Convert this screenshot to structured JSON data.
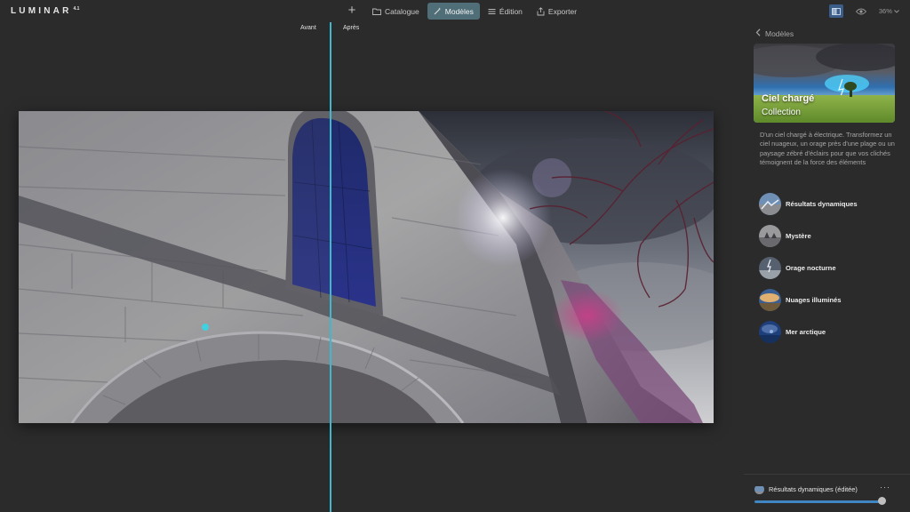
{
  "app": {
    "name": "LUMINAR",
    "version": "4.1"
  },
  "toolbar": {
    "add_label": "+",
    "tabs": [
      {
        "label": "Catalogue",
        "icon": "folder-icon",
        "active": false
      },
      {
        "label": "Modèles",
        "icon": "wand-icon",
        "active": true
      },
      {
        "label": "Édition",
        "icon": "sliders-icon",
        "active": false
      },
      {
        "label": "Exporter",
        "icon": "share-icon",
        "active": false
      }
    ],
    "zoom": "36%"
  },
  "canvas": {
    "before_label": "Avant",
    "after_label": "Après",
    "split_position": 0.45
  },
  "panel": {
    "back_label": "Modèles",
    "collection_title": "Ciel chargé",
    "collection_subtitle": "Collection",
    "description": "D'un ciel chargé à électrique. Transformez un ciel nuageux, un orage près d'une plage ou un paysage zébré d'éclairs pour que vos clichés témoignent de la force des éléments",
    "presets": [
      {
        "label": "Résultats dynamiques"
      },
      {
        "label": "Mystère"
      },
      {
        "label": "Orage nocturne"
      },
      {
        "label": "Nuages illuminés"
      },
      {
        "label": "Mer arctique"
      }
    ],
    "applied": {
      "label": "Résultats dynamiques (éditée)",
      "more_label": "···",
      "amount": 1.0
    }
  },
  "colors": {
    "accent": "#3fb8cc",
    "active_tab": "#4f6e78",
    "slider": "#3f86c2",
    "background": "#2b2b2c"
  }
}
